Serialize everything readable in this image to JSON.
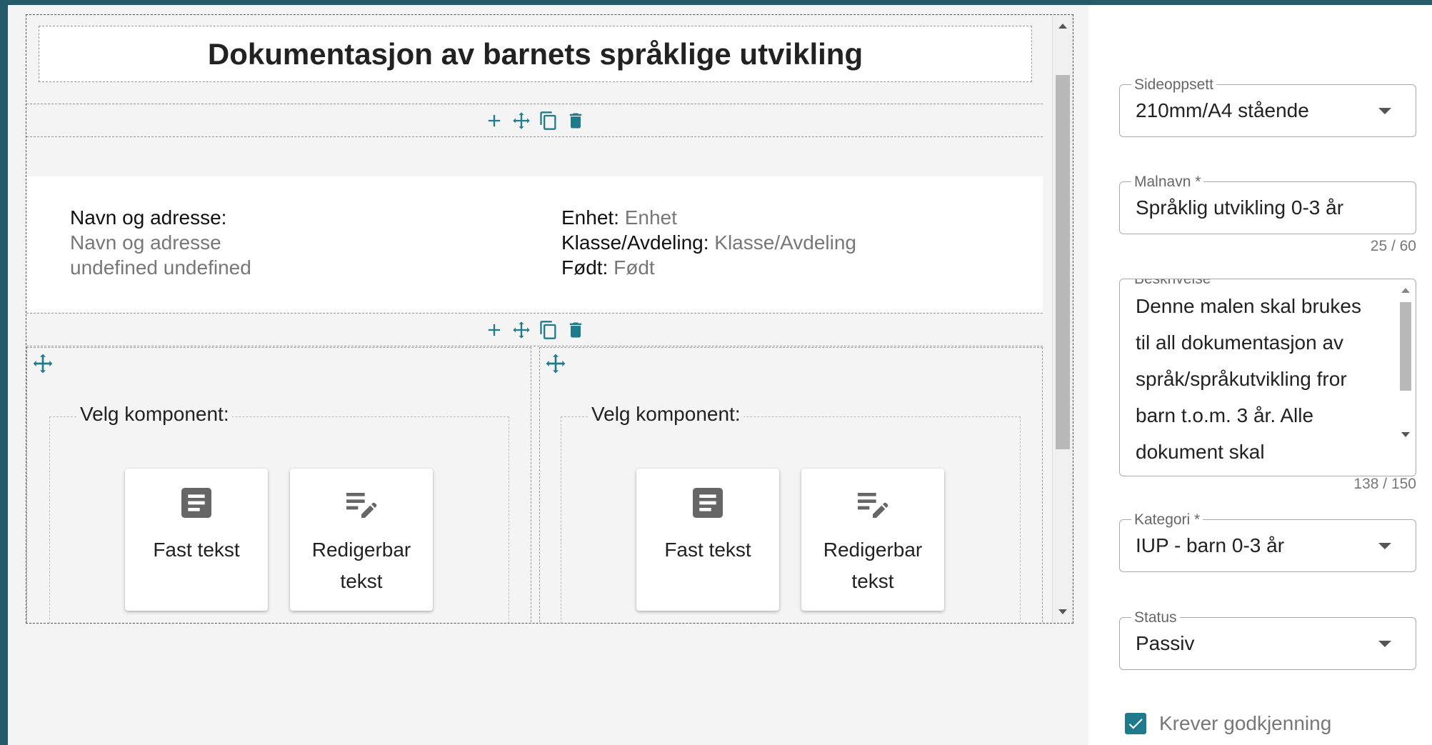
{
  "editor": {
    "title": "Dokumentasjon av barnets språklige utvikling",
    "info_left": {
      "label": "Navn og adresse:",
      "value_line1": "Navn og adresse",
      "value_line2": "undefined undefined"
    },
    "info_right": {
      "unit_label": "Enhet:",
      "unit_value": "Enhet",
      "class_label": "Klasse/Avdeling:",
      "class_value": "Klasse/Avdeling",
      "born_label": "Født:",
      "born_value": "Født"
    },
    "columns": [
      {
        "legend": "Velg komponent:",
        "cards": [
          {
            "label": "Fast tekst",
            "icon": "article-icon"
          },
          {
            "label": "Redigerbar tekst",
            "icon": "edit-note-icon"
          }
        ]
      },
      {
        "legend": "Velg komponent:",
        "cards": [
          {
            "label": "Fast tekst",
            "icon": "article-icon"
          },
          {
            "label": "Redigerbar tekst",
            "icon": "edit-note-icon"
          }
        ]
      }
    ],
    "toolbar_icons": [
      "add-icon",
      "move-icon",
      "copy-icon",
      "delete-icon"
    ]
  },
  "settings": {
    "layout": {
      "label": "Sideoppsett",
      "value": "210mm/A4 stående"
    },
    "template_name": {
      "label": "Malnavn *",
      "value": "Språklig utvikling 0-3 år",
      "counter": "25 / 60"
    },
    "description": {
      "label": "Beskrivelse",
      "value": "Denne malen skal brukes\ntil all dokumentasjon av\nspråk/språkutvikling fror\nbarn t.o.m. 3 år. Alle\ndokument skal",
      "counter": "138 / 150"
    },
    "category": {
      "label": "Kategori *",
      "value": "IUP - barn 0-3 år"
    },
    "status": {
      "label": "Status",
      "value": "Passiv"
    },
    "approval": {
      "label": "Krever godkjenning",
      "checked": true
    }
  },
  "colors": {
    "accent": "#1f7a8c",
    "window_frame": "#255a6b"
  }
}
